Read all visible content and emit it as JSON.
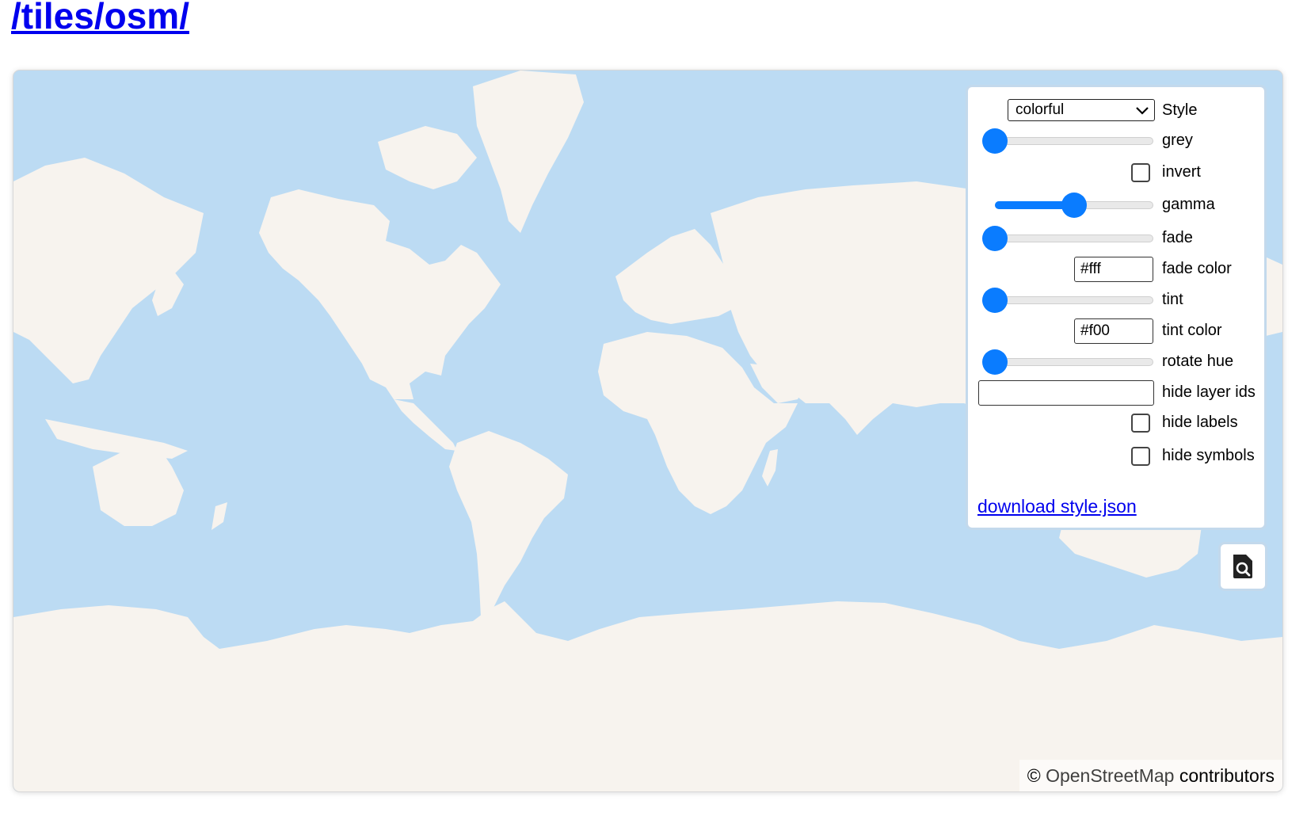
{
  "page": {
    "title": "/tiles/osm/"
  },
  "controls": {
    "style": {
      "label": "Style",
      "value": "colorful"
    },
    "grey": {
      "label": "grey",
      "value": 0
    },
    "invert": {
      "label": "invert",
      "checked": false
    },
    "gamma": {
      "label": "gamma",
      "value": 0.5
    },
    "fade": {
      "label": "fade",
      "value": 0
    },
    "fade_color": {
      "label": "fade color",
      "value": "#fff"
    },
    "tint": {
      "label": "tint",
      "value": 0
    },
    "tint_color": {
      "label": "tint color",
      "value": "#f00"
    },
    "rotate_hue": {
      "label": "rotate hue",
      "value": 0
    },
    "hide_layer_ids": {
      "label": "hide layer ids",
      "value": ""
    },
    "hide_labels": {
      "label": "hide labels",
      "checked": false
    },
    "hide_symbols": {
      "label": "hide symbols",
      "checked": false
    },
    "download_link": "download style.json"
  },
  "attribution": {
    "symbol": "©",
    "link": "OpenStreetMap",
    "suffix": "contributors"
  },
  "colors": {
    "water": "#bcdbf3",
    "land": "#f7f3ee",
    "accent": "#0a7cff",
    "link": "#0000ee"
  },
  "icons": {
    "inspect": "file-search-icon",
    "dropdown": "chevron-down-icon"
  }
}
